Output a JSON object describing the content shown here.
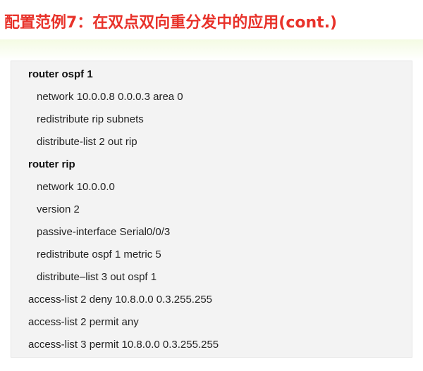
{
  "slide": {
    "title": "配置范例7：在双点双向重分发中的应用(cont.)",
    "title_color": "#e8322a",
    "config_lines": [
      {
        "text": "router ospf 1",
        "bold": true,
        "indent": false
      },
      {
        "text": "network  10.0.0.8 0.0.0.3 area 0",
        "bold": false,
        "indent": true
      },
      {
        "text": "redistribute rip subnets",
        "bold": false,
        "indent": true
      },
      {
        "text": "distribute-list 2 out rip",
        "bold": false,
        "indent": true
      },
      {
        "text": "router rip",
        "bold": true,
        "indent": false
      },
      {
        "text": "network 10.0.0.0",
        "bold": false,
        "indent": true
      },
      {
        "text": "version 2",
        "bold": false,
        "indent": true
      },
      {
        "text": "passive-interface Serial0/0/3",
        "bold": false,
        "indent": true
      },
      {
        "text": "redistribute ospf 1 metric 5",
        "bold": false,
        "indent": true
      },
      {
        "text": "distribute–list 3 out ospf 1",
        "bold": false,
        "indent": true
      },
      {
        "text": "access-list 2 deny 10.8.0.0 0.3.255.255",
        "bold": false,
        "indent": false
      },
      {
        "text": "access-list 2 permit any",
        "bold": false,
        "indent": false
      },
      {
        "text": "access-list 3 permit 10.8.0.0 0.3.255.255",
        "bold": false,
        "indent": false
      }
    ]
  }
}
